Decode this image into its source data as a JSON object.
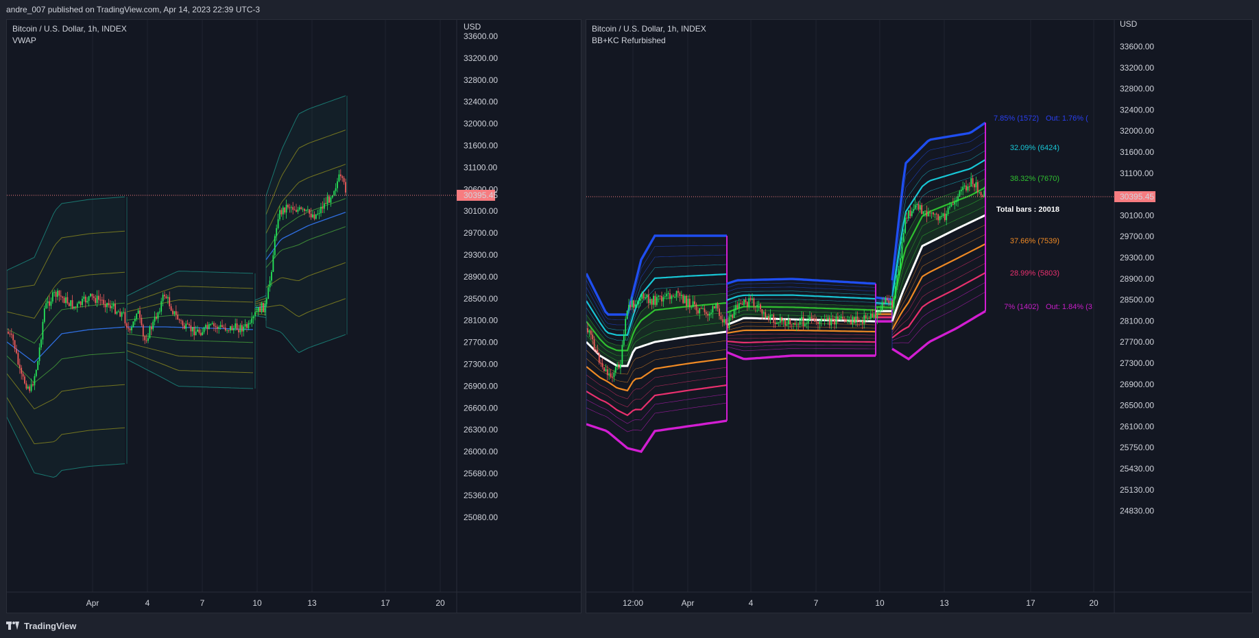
{
  "header": {
    "publisher": "andre_007 published on TradingView.com, Apr 14, 2023 22:39 UTC-3"
  },
  "footer": {
    "brand": "TradingView"
  },
  "colors": {
    "background": "#131722",
    "frame": "#1e222d",
    "grid": "#1f2330",
    "up": "#26e65a",
    "down": "#f05a5a",
    "price_tag": "#f77c80",
    "band_teal": "#1b8f83",
    "band_olive": "#8c8b1e",
    "band_green": "#47a33a",
    "vwap_blue": "#2f6ee0",
    "bb_blue": "#1f4ef0",
    "bb_cyan": "#18c7d6",
    "bb_green": "#30c030",
    "bb_white": "#ffffff",
    "bb_orange": "#f08a24",
    "bb_pink": "#e8306e",
    "bb_magenta": "#d21ed2"
  },
  "charts": [
    {
      "id": "left",
      "symbol": "Bitcoin / U.S. Dollar, 1h, INDEX",
      "indicator": "VWAP",
      "currency": "USD",
      "last_price": "30395.45",
      "price_ticks": [
        "33600.00",
        "33200.00",
        "32800.00",
        "32400.00",
        "32000.00",
        "31600.00",
        "31100.00",
        "30600.00",
        "30100.00",
        "29700.00",
        "29300.00",
        "28900.00",
        "28500.00",
        "28100.00",
        "27700.00",
        "27300.00",
        "26900.00",
        "26600.00",
        "26300.00",
        "26000.00",
        "25680.00",
        "25360.00",
        "25080.00"
      ],
      "time_ticks": [
        "Apr",
        "4",
        "7",
        "10",
        "13",
        "17",
        "20"
      ]
    },
    {
      "id": "right",
      "symbol": "Bitcoin / U.S. Dollar, 1h, INDEX",
      "indicator": "BB+KC Refurbished",
      "currency": "USD",
      "last_price": "30395.45",
      "price_ticks": [
        "33600.00",
        "33200.00",
        "32800.00",
        "32400.00",
        "32000.00",
        "31600.00",
        "31100.00",
        "30600.00",
        "30100.00",
        "29700.00",
        "29300.00",
        "28900.00",
        "28500.00",
        "28100.00",
        "27700.00",
        "27300.00",
        "26900.00",
        "26500.00",
        "26100.00",
        "25750.00",
        "25430.00",
        "25130.00",
        "24830.00"
      ],
      "time_ticks": [
        "12:00",
        "Apr",
        "4",
        "7",
        "10",
        "13",
        "17",
        "20"
      ],
      "stats": [
        {
          "text": "7.85% (1572)",
          "extra": "Out: 1.76% (",
          "color": "#2a3ff0"
        },
        {
          "text": "32.09% (6424)",
          "color": "#18c7d6"
        },
        {
          "text": "38.32% (7670)",
          "color": "#30c030"
        },
        {
          "text": "Total bars : 20018",
          "color": "#ffffff",
          "bold": true
        },
        {
          "text": "37.66% (7539)",
          "color": "#f08a24"
        },
        {
          "text": "28.99% (5803)",
          "color": "#e8306e"
        },
        {
          "text": "7% (1402)",
          "extra": "Out: 1.84% (3",
          "color": "#c81ec8"
        }
      ]
    }
  ]
}
